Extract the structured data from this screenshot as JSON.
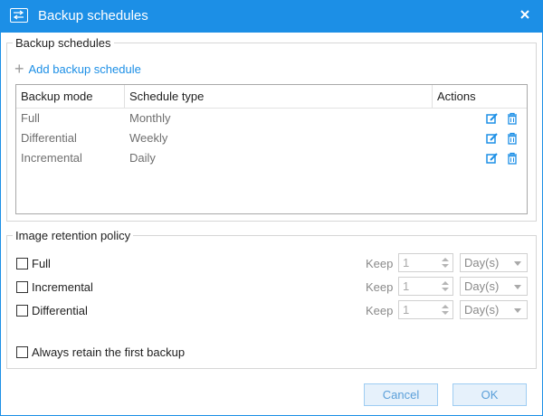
{
  "window": {
    "title": "Backup schedules",
    "close_icon": "close-icon"
  },
  "schedules": {
    "legend": "Backup schedules",
    "add_label": "Add backup schedule",
    "columns": [
      "Backup mode",
      "Schedule type",
      "Actions"
    ],
    "rows": [
      {
        "mode": "Full",
        "type": "Monthly"
      },
      {
        "mode": "Differential",
        "type": "Weekly"
      },
      {
        "mode": "Incremental",
        "type": "Daily"
      }
    ]
  },
  "retention": {
    "legend": "Image retention policy",
    "items": [
      {
        "label": "Full",
        "keep_label": "Keep",
        "value": "1",
        "unit": "Day(s)"
      },
      {
        "label": "Incremental",
        "keep_label": "Keep",
        "value": "1",
        "unit": "Day(s)"
      },
      {
        "label": "Differential",
        "keep_label": "Keep",
        "value": "1",
        "unit": "Day(s)"
      }
    ],
    "always_retain_label": "Always retain the first backup"
  },
  "buttons": {
    "cancel": "Cancel",
    "ok": "OK"
  },
  "colors": {
    "accent": "#1c8fe6",
    "button_bg": "#e6f1fb",
    "button_text": "#5a9fd9"
  }
}
